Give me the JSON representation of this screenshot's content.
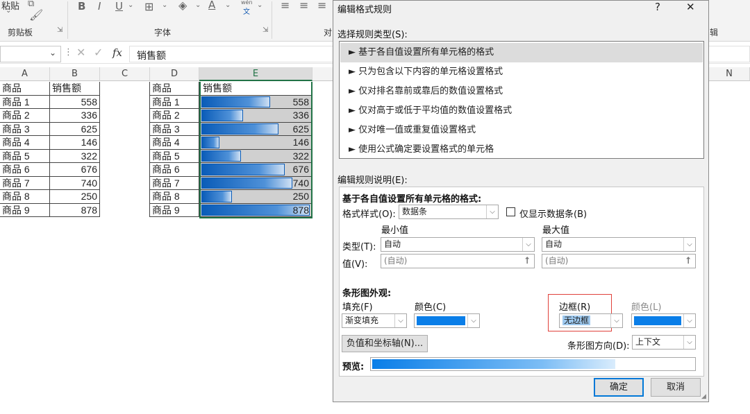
{
  "ribbon": {
    "paste": "粘贴",
    "clipboard": "剪贴板",
    "font": "字体",
    "align_partial": "对",
    "edit_partial": "辑",
    "bold": "B",
    "italic": "I",
    "underline": "U",
    "font_color_glyph": "A",
    "wen_top": "wén",
    "wen_char": "文"
  },
  "formula_bar": {
    "fx": "fx",
    "content": "销售额"
  },
  "columns": [
    "A",
    "B",
    "C",
    "D",
    "E",
    "N"
  ],
  "table_left": {
    "header": [
      "商品",
      "销售额"
    ],
    "rows": [
      [
        "商品 1",
        "558"
      ],
      [
        "商品 2",
        "336"
      ],
      [
        "商品 3",
        "625"
      ],
      [
        "商品 4",
        "146"
      ],
      [
        "商品 5",
        "322"
      ],
      [
        "商品 6",
        "676"
      ],
      [
        "商品 7",
        "740"
      ],
      [
        "商品 8",
        "250"
      ],
      [
        "商品 9",
        "878"
      ]
    ]
  },
  "table_right": {
    "header": [
      "商品",
      "销售额"
    ],
    "rows": [
      {
        "name": "商品 1",
        "value": 558
      },
      {
        "name": "商品 2",
        "value": 336
      },
      {
        "name": "商品 3",
        "value": 625
      },
      {
        "name": "商品 4",
        "value": 146
      },
      {
        "name": "商品 5",
        "value": 322
      },
      {
        "name": "商品 6",
        "value": 676
      },
      {
        "name": "商品 7",
        "value": 740
      },
      {
        "name": "商品 8",
        "value": 250
      },
      {
        "name": "商品 9",
        "value": 878
      }
    ]
  },
  "dialog": {
    "title": "编辑格式规则",
    "help": "?",
    "close": "✕",
    "rule_type_label": "选择规则类型(S):",
    "rule_types": [
      "► 基于各自值设置所有单元格的格式",
      "► 只为包含以下内容的单元格设置格式",
      "► 仅对排名靠前或靠后的数值设置格式",
      "► 仅对高于或低于平均值的数值设置格式",
      "► 仅对唯一值或重复值设置格式",
      "► 使用公式确定要设置格式的单元格"
    ],
    "desc_label": "编辑规则说明(E):",
    "desc_heading": "基于各自值设置所有单元格的格式:",
    "format_style_label": "格式样式(O):",
    "format_style_value": "数据条",
    "show_bar_only": "仅显示数据条(B)",
    "min_label": "最小值",
    "max_label": "最大值",
    "type_label": "类型(T):",
    "value_label": "值(V):",
    "min_type": "自动",
    "max_type": "自动",
    "min_value_placeholder": "(自动)",
    "max_value_placeholder": "(自动)",
    "appearance_label": "条形图外观:",
    "fill_label": "填充(F)",
    "color_label": "颜色(C)",
    "border_label": "边框(R)",
    "border_color_label": "颜色(L)",
    "fill_value": "渐变填充",
    "border_value": "无边框",
    "negative_axis_btn": "负值和坐标轴(N)...",
    "direction_label": "条形图方向(D):",
    "direction_value": "上下文",
    "preview_label": "预览:",
    "ok": "确定",
    "cancel": "取消"
  },
  "colors": {
    "bar_color": "#0a7ee8",
    "highlight_border": "#e0403a",
    "excel_green": "#217346"
  }
}
